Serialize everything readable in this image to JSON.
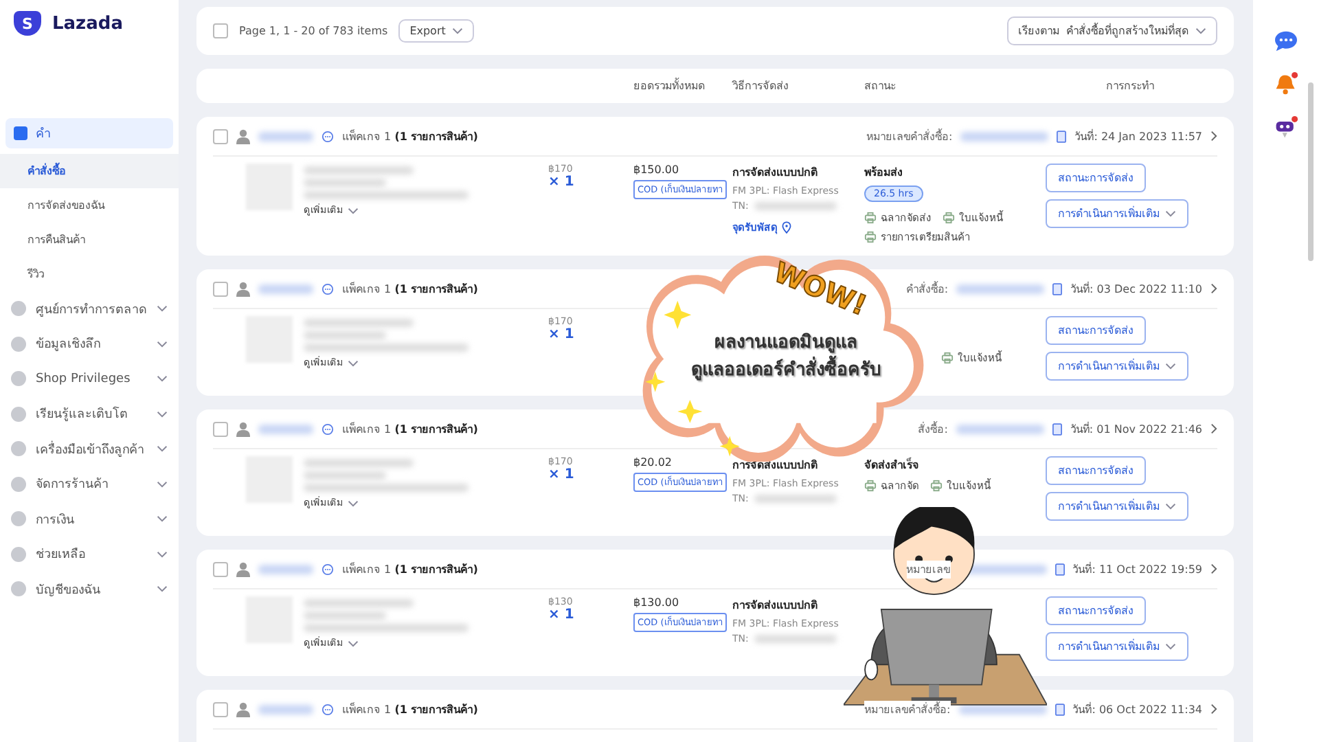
{
  "sidebar": {
    "logo": {
      "mark": "S",
      "name": "Lazada"
    },
    "group": {
      "label": "คำ",
      "items": [
        {
          "label": "คำสั่งซื้อ",
          "selected": true
        },
        {
          "label": "การจัดส่งของฉัน",
          "selected": false
        },
        {
          "label": "การคืนสินค้า",
          "selected": false
        },
        {
          "label": "รีวิว",
          "selected": false
        }
      ]
    },
    "menu": [
      "ศูนย์การทำการตลาด",
      "ข้อมูลเชิงลึก",
      "Shop Privileges",
      "เรียนรู้และเติบโต",
      "เครื่องมือเข้าถึงลูกค้า",
      "จัดการร้านค้า",
      "การเงิน",
      "ช่วยเหลือ",
      "บัญชีของฉัน"
    ]
  },
  "toolbar": {
    "checked": false,
    "page_info": "Page 1, 1 - 20 of 783 items",
    "export": "Export",
    "sort_label": "เรียงตาม",
    "sort_value": "คำสั่งซื้อที่ถูกสร้างใหม่ที่สุด"
  },
  "columns": {
    "total": "ยอดรวมทั้งหมด",
    "shipping": "วิธีการจัดส่ง",
    "status": "สถานะ",
    "actions": "การกระทำ"
  },
  "orders": [
    {
      "package": "แพ็คเกจ 1",
      "items": "(1 รายการสินค้า)",
      "checked": false,
      "order_label": "หมายเลขคำสั่งซื้อ:",
      "date": "วันที่: 24 Jan 2023 11:57",
      "more": "ดูเพิ่มเติม",
      "price": "฿170",
      "qty": "× 1",
      "total": "฿150.00",
      "payment": "COD (เก็บเงินปลายทา",
      "ship_type": "การจัดส่งแบบปกติ",
      "carrier": "FM 3PL: Flash Express",
      "tn": "TN:",
      "pickup": "จุดรับพัสดุ",
      "status": "พร้อมส่ง",
      "badge": "26.5 hrs",
      "links": [
        "ฉลากจัดส่ง",
        "ใบแจ้งหนี้",
        "รายการเตรียมสินค้า"
      ],
      "buttons": [
        "สถานะการจัดส่ง",
        "การดำเนินการเพิ่มเติม"
      ]
    },
    {
      "package": "แพ็คเกจ 1",
      "items": "(1 รายการสินค้า)",
      "checked": false,
      "order_label": "คำสั่งซื้อ:",
      "date": "วันที่: 03 Dec 2022 11:10",
      "more": "ดูเพิ่มเติม",
      "price": "฿170",
      "qty": "× 1",
      "links": [
        "ใบแจ้งหนี้"
      ],
      "buttons": [
        "สถานะการจัดส่ง",
        "การดำเนินการเพิ่มเติม"
      ]
    },
    {
      "package": "แพ็คเกจ 1",
      "items": "(1 รายการสินค้า)",
      "checked": false,
      "order_label": "สั่งซื้อ:",
      "date": "วันที่: 01 Nov 2022 21:46",
      "more": "ดูเพิ่มเติม",
      "price": "฿170",
      "qty": "× 1",
      "total": "฿20.02",
      "payment": "COD (เก็บเงินปลายทา",
      "ship_type": "การจัดส่งแบบปกติ",
      "carrier": "FM 3PL: Flash Express",
      "tn": "TN:",
      "status": "จัดส่งสำเร็จ",
      "links": [
        "ฉลากจัด",
        "ใบแจ้งหนี้"
      ],
      "buttons": [
        "สถานะการจัดส่ง",
        "การดำเนินการเพิ่มเติม"
      ]
    },
    {
      "package": "แพ็คเกจ 1",
      "items": "(1 รายการสินค้า)",
      "checked": false,
      "order_label": "หมายเลข",
      "date": "วันที่: 11 Oct 2022 19:59",
      "more": "ดูเพิ่มเติม",
      "price": "฿130",
      "qty": "× 1",
      "total": "฿130.00",
      "payment": "COD (เก็บเงินปลายทา",
      "ship_type": "การจัดส่งแบบปกติ",
      "carrier": "FM 3PL: Flash Express",
      "tn": "TN:",
      "buttons": [
        "สถานะการจัดส่ง",
        "การดำเนินการเพิ่มเติม"
      ]
    },
    {
      "package": "แพ็คเกจ 1",
      "items": "(1 รายการสินค้า)",
      "checked": false,
      "order_label": "หมายเลขคำสั่งซื้อ:",
      "date": "วันที่: 06 Oct 2022 11:34"
    }
  ],
  "bubble": {
    "exclamation": "WOW!",
    "lines": [
      "ผลงานแอดมินดูแล",
      "ดูแลออเดอร์คำสั่งซื้อครับ"
    ]
  }
}
